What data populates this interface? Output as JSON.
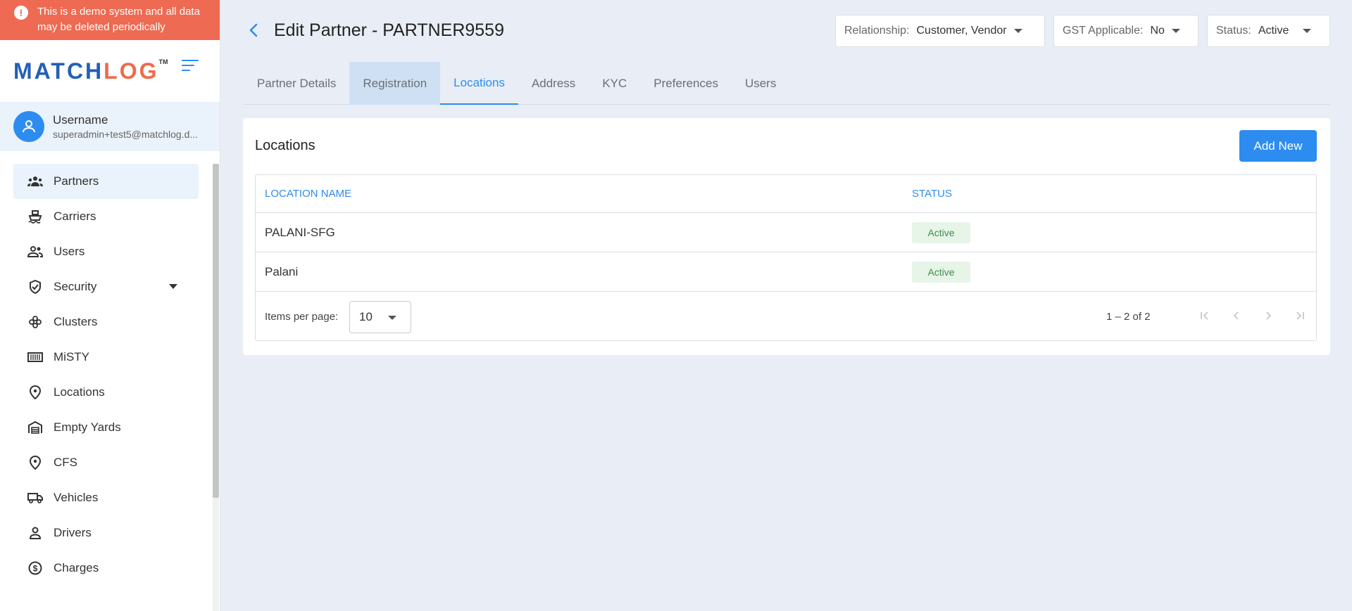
{
  "banner": {
    "text": "This is a demo system and all data may be deleted periodically"
  },
  "logo": {
    "match": "MATCH",
    "log": "LOG",
    "tm": "TM"
  },
  "user": {
    "name": "Username",
    "email": "superadmin+test5@matchlog.d..."
  },
  "sidebar": {
    "items": [
      {
        "label": "Partners",
        "icon": "partners-icon"
      },
      {
        "label": "Carriers",
        "icon": "ship-icon"
      },
      {
        "label": "Users",
        "icon": "users-icon"
      },
      {
        "label": "Security",
        "icon": "shield-icon"
      },
      {
        "label": "Clusters",
        "icon": "cluster-icon"
      },
      {
        "label": "MiSTY",
        "icon": "container-icon"
      },
      {
        "label": "Locations",
        "icon": "pin-icon"
      },
      {
        "label": "Empty Yards",
        "icon": "warehouse-icon"
      },
      {
        "label": "CFS",
        "icon": "pin-icon"
      },
      {
        "label": "Vehicles",
        "icon": "truck-icon"
      },
      {
        "label": "Drivers",
        "icon": "person-icon"
      },
      {
        "label": "Charges",
        "icon": "dollar-icon"
      }
    ]
  },
  "header": {
    "title": "Edit Partner - PARTNER9559",
    "relationship": {
      "label": "Relationship:",
      "value": "Customer, Vendor"
    },
    "gst": {
      "label": "GST Applicable:",
      "value": "No"
    },
    "status": {
      "label": "Status:",
      "value": "Active"
    }
  },
  "tabs": [
    {
      "label": "Partner Details"
    },
    {
      "label": "Registration"
    },
    {
      "label": "Locations"
    },
    {
      "label": "Address"
    },
    {
      "label": "KYC"
    },
    {
      "label": "Preferences"
    },
    {
      "label": "Users"
    }
  ],
  "card": {
    "title": "Locations",
    "add_label": "Add New",
    "columns": {
      "name": "LOCATION NAME",
      "status": "STATUS"
    },
    "rows": [
      {
        "name": "PALANI-SFG",
        "status": "Active"
      },
      {
        "name": "Palani",
        "status": "Active"
      }
    ],
    "paginator": {
      "items_per_page_label": "Items per page:",
      "page_size": "10",
      "range": "1 – 2 of 2"
    }
  }
}
